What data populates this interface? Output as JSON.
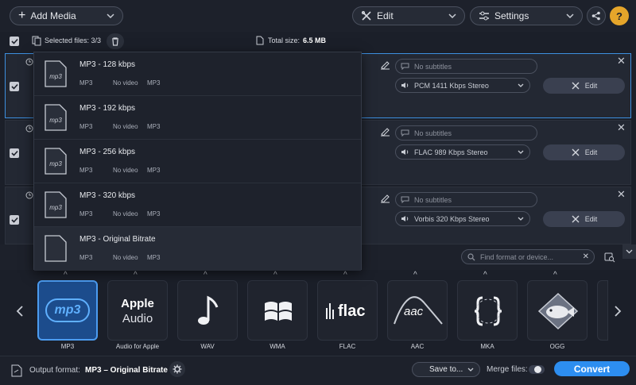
{
  "toolbar": {
    "add_media": "Add Media",
    "edit": "Edit",
    "settings": "Settings"
  },
  "selection": {
    "selected_label": "Selected files: 3/3",
    "total_size_label": "Total size:",
    "total_size_value": "6.5 MB"
  },
  "rows": [
    {
      "subtitles": "No subtitles",
      "audio": "PCM 1411 Kbps Stereo",
      "edit": "Edit"
    },
    {
      "subtitles": "No subtitles",
      "audio": "FLAC 989 Kbps Stereo",
      "edit": "Edit"
    },
    {
      "subtitles": "No subtitles",
      "audio": "Vorbis 320 Kbps Stereo",
      "edit": "Edit"
    }
  ],
  "presets": [
    {
      "title": "MP3 - 128 kbps",
      "container": "MP3",
      "video": "No video",
      "audio": "MP3",
      "icon_text": "mp3"
    },
    {
      "title": "MP3 - 192 kbps",
      "container": "MP3",
      "video": "No video",
      "audio": "MP3",
      "icon_text": "mp3"
    },
    {
      "title": "MP3 - 256 kbps",
      "container": "MP3",
      "video": "No video",
      "audio": "MP3",
      "icon_text": "mp3"
    },
    {
      "title": "MP3 - 320 kbps",
      "container": "MP3",
      "video": "No video",
      "audio": "MP3",
      "icon_text": "mp3"
    },
    {
      "title": "MP3 - Original Bitrate",
      "container": "MP3",
      "video": "No video",
      "audio": "MP3"
    }
  ],
  "search": {
    "placeholder": "Find format or device..."
  },
  "formats": [
    {
      "label": "MP3",
      "art": "mp3"
    },
    {
      "label": "Audio for Apple",
      "art_line1": "Apple",
      "art_line2": "Audio"
    },
    {
      "label": "WAV"
    },
    {
      "label": "WMA"
    },
    {
      "label": "FLAC",
      "art": "flac"
    },
    {
      "label": "AAC",
      "art": "aac"
    },
    {
      "label": "MKA"
    },
    {
      "label": "OGG"
    }
  ],
  "bottom": {
    "output_label": "Output format:",
    "output_value": "MP3 – Original Bitrate",
    "save_to": "Save to...",
    "merge_files": "Merge files:",
    "convert": "Convert"
  },
  "colors": {
    "accent": "#2d8ef0",
    "selected_tile": "#1c4c8c",
    "background": "#1b1f29"
  }
}
